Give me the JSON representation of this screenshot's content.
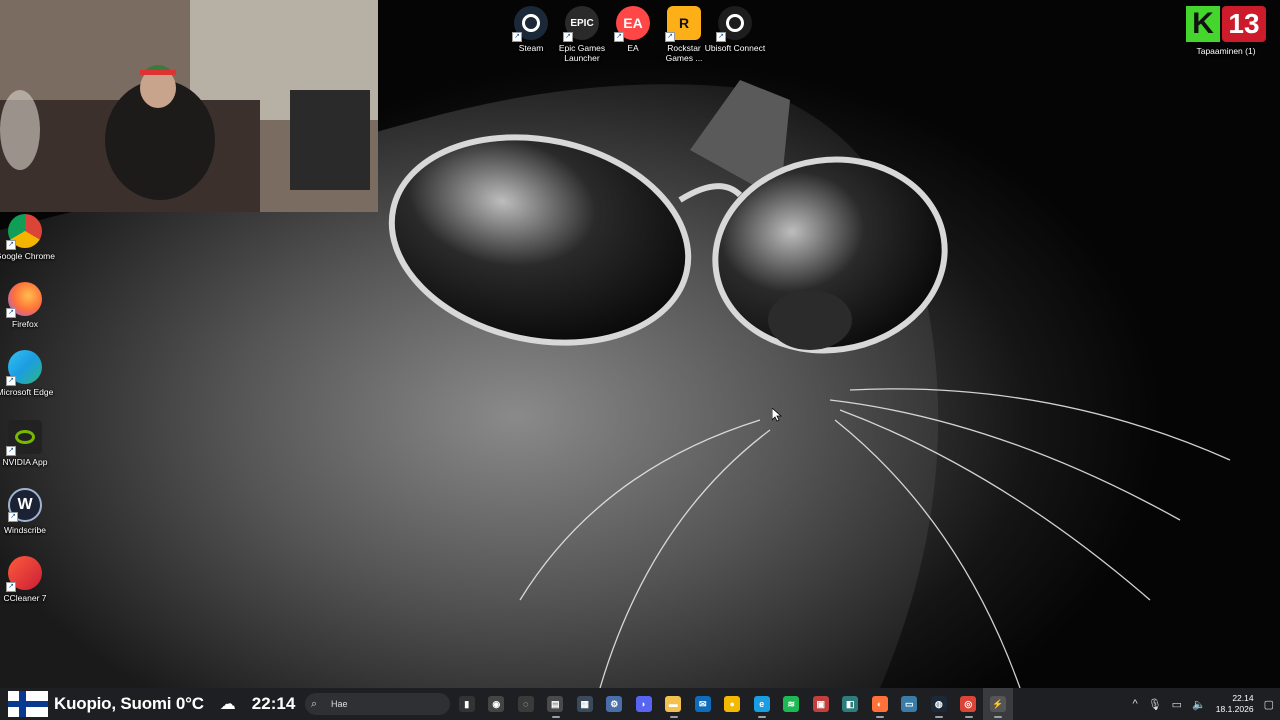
{
  "top_icons": [
    {
      "name": "steam-shortcut",
      "icon": "steam-icon",
      "label": "Steam",
      "color": "#1b2838"
    },
    {
      "name": "epic-games-launcher-shortcut",
      "icon": "epic-games-icon",
      "label": "Epic Games Launcher",
      "color": "#2a2a2a",
      "glyph_text": "EPIC"
    },
    {
      "name": "ea-shortcut",
      "icon": "ea-icon",
      "label": "EA",
      "color": "#ff4747",
      "glyph_text": "EA"
    },
    {
      "name": "rockstar-games-shortcut",
      "icon": "rockstar-icon",
      "label": "Rockstar Games ...",
      "color": "#fcaf17",
      "glyph_text": "R"
    },
    {
      "name": "ubisoft-connect-shortcut",
      "icon": "ubisoft-icon",
      "label": "Ubisoft Connect",
      "color": "#1d1d1d"
    }
  ],
  "left_icons": [
    {
      "name": "google-chrome-shortcut",
      "icon": "chrome-icon",
      "label": "Google Chrome"
    },
    {
      "name": "firefox-shortcut",
      "icon": "firefox-icon",
      "label": "Firefox"
    },
    {
      "name": "microsoft-edge-shortcut",
      "icon": "edge-icon",
      "label": "Microsoft Edge"
    },
    {
      "name": "nvidia-app-shortcut",
      "icon": "nvidia-icon",
      "label": "NVIDIA App"
    },
    {
      "name": "windscribe-shortcut",
      "icon": "windscribe-icon",
      "label": "Windscribe",
      "glyph_text": "W"
    },
    {
      "name": "ccleaner-shortcut",
      "icon": "ccleaner-icon",
      "label": "CCleaner 7"
    }
  ],
  "meeting_badge": {
    "k": "K",
    "number": "13",
    "label": "Tapaaminen (1)",
    "k_color": "#44d62c",
    "num_color": "#cc1b2b"
  },
  "taskbar": {
    "weather": {
      "location_temp": "Kuopio, Suomi 0°C",
      "weather_icon": "cloud-icon",
      "overlay_time": "22:14"
    },
    "search": {
      "placeholder": "Hae"
    },
    "pinned": [
      {
        "name": "taskbar-audio-visualizer",
        "icon": "equalizer-icon",
        "glyph": "▮",
        "color": "#333"
      },
      {
        "name": "taskbar-maps",
        "icon": "location-icon",
        "glyph": "◉",
        "color": "#444"
      },
      {
        "name": "taskbar-app-3",
        "icon": "circle-arrow-icon",
        "glyph": "◌",
        "color": "#3a3a3a"
      },
      {
        "name": "taskbar-app-4",
        "icon": "document-icon",
        "glyph": "▤",
        "color": "#4a4a4a"
      },
      {
        "name": "taskbar-calculator",
        "icon": "calculator-icon",
        "glyph": "▦",
        "color": "#3a4a5a"
      },
      {
        "name": "taskbar-settings",
        "icon": "gear-icon",
        "glyph": "⚙",
        "color": "#4a6ea9"
      },
      {
        "name": "taskbar-discord",
        "icon": "discord-icon",
        "glyph": "◗",
        "color": "#5865f2"
      },
      {
        "name": "taskbar-file-explorer",
        "icon": "folder-icon",
        "glyph": "▬",
        "color": "#f2c14e"
      },
      {
        "name": "taskbar-outlook",
        "icon": "mail-icon",
        "glyph": "✉",
        "color": "#0f6cbd"
      },
      {
        "name": "taskbar-app-10",
        "icon": "yellow-app-icon",
        "glyph": "●",
        "color": "#f5b800"
      },
      {
        "name": "taskbar-edge",
        "icon": "edge-icon",
        "glyph": "e",
        "color": "#1b9de2"
      },
      {
        "name": "taskbar-spotify",
        "icon": "spotify-icon",
        "glyph": "≋",
        "color": "#1db954"
      },
      {
        "name": "taskbar-app-13",
        "icon": "image-icon",
        "glyph": "▣",
        "color": "#c04040"
      },
      {
        "name": "taskbar-app-14",
        "icon": "window-icon",
        "glyph": "◧",
        "color": "#2e7d7d"
      },
      {
        "name": "taskbar-firefox",
        "icon": "firefox-icon",
        "glyph": "◐",
        "color": "#ff7139"
      },
      {
        "name": "taskbar-app-16",
        "icon": "monitor-icon",
        "glyph": "▭",
        "color": "#3a7ca5"
      },
      {
        "name": "taskbar-steam",
        "icon": "steam-icon",
        "glyph": "◍",
        "color": "#1b2838"
      },
      {
        "name": "taskbar-chrome",
        "icon": "chrome-icon",
        "glyph": "◎",
        "color": "#db4437"
      },
      {
        "name": "taskbar-app-19",
        "icon": "bolt-icon",
        "glyph": "⚡",
        "color": "#555"
      }
    ],
    "tray": {
      "chevron": "^",
      "clock_time": "22.14",
      "clock_date": "18.1.2026"
    }
  }
}
